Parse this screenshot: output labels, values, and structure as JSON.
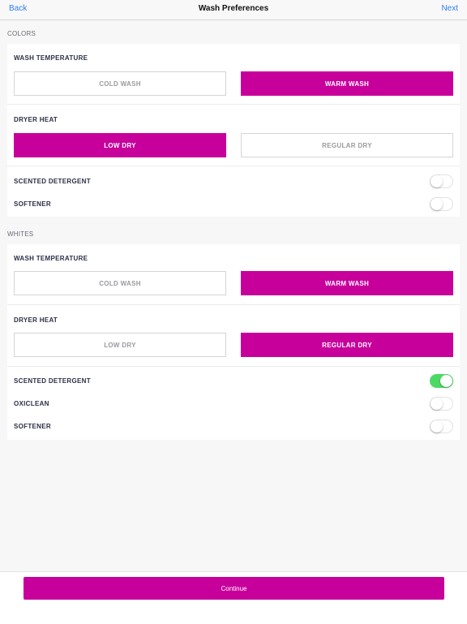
{
  "nav": {
    "back_label": "Back",
    "title": "Wash Preferences",
    "next_label": "Next"
  },
  "colors": {
    "section_label": "COLORS",
    "wash_temperature_label": "WASH TEMPERATURE",
    "wash_options": [
      "COLD WASH",
      "WARM WASH"
    ],
    "wash_selected": "WARM WASH",
    "dryer_heat_label": "DRYER HEAT",
    "dryer_options": [
      "LOW DRY",
      "REGULAR DRY"
    ],
    "dryer_selected": "LOW DRY",
    "toggles": [
      {
        "label": "SCENTED DETERGENT",
        "on": false
      },
      {
        "label": "SOFTENER",
        "on": false
      }
    ]
  },
  "whites": {
    "section_label": "WHITES",
    "wash_temperature_label": "WASH TEMPERATURE",
    "wash_options": [
      "COLD WASH",
      "WARM WASH"
    ],
    "wash_selected": "WARM WASH",
    "dryer_heat_label": "DRYER HEAT",
    "dryer_options": [
      "LOW DRY",
      "REGULAR DRY"
    ],
    "dryer_selected": "REGULAR DRY",
    "toggles": [
      {
        "label": "SCENTED DETERGENT",
        "on": true
      },
      {
        "label": "OXICLEAN",
        "on": false
      },
      {
        "label": "SOFTENER",
        "on": false
      }
    ]
  },
  "footer": {
    "continue_label": "Continue"
  },
  "theme": {
    "accent": "#c8009b",
    "toggle_on": "#4cd964",
    "link": "#2f7df6"
  }
}
